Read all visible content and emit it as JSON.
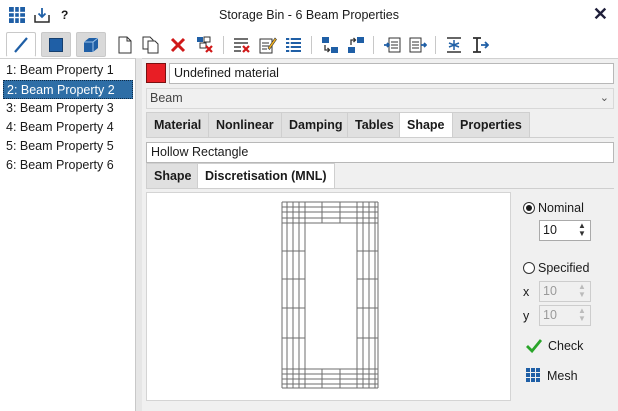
{
  "window": {
    "title": "Storage Bin - 6 Beam Properties",
    "help_label": "?"
  },
  "toolbar": {
    "icons": [
      "grid-app-icon",
      "download-icon",
      "help-icon",
      "line-mode-icon",
      "area-mode-icon",
      "solid-mode-icon",
      "new-page-icon",
      "copy-icon",
      "delete-icon",
      "delete-unused-icon",
      "delete-list-icon",
      "edit-list-icon",
      "list-icon",
      "import-icon",
      "export-icon",
      "insert-before-icon",
      "insert-after-icon",
      "align-center-icon",
      "section-icon"
    ]
  },
  "properties": {
    "items": [
      "1: Beam Property 1",
      "2: Beam Property 2",
      "3: Beam Property 3",
      "4: Beam Property 4",
      "5: Beam Property 5",
      "6: Beam Property 6"
    ],
    "selected_index": 1
  },
  "material": {
    "name": "Undefined material",
    "color": "#e81e25"
  },
  "element_type": {
    "value": "Beam"
  },
  "tabs": {
    "main": [
      "Material",
      "Nonlinear",
      "Damping",
      "Tables",
      "Shape",
      "Properties"
    ],
    "main_active": "Shape",
    "sub": [
      "Shape",
      "Discretisation (MNL)"
    ],
    "sub_active": "Discretisation (MNL)"
  },
  "shape": {
    "name": "Hollow Rectangle"
  },
  "discretisation": {
    "nominal_label": "Nominal",
    "nominal_value": "10",
    "nominal_selected": true,
    "specified_label": "Specified",
    "x_label": "x",
    "x_value": "10",
    "y_label": "y",
    "y_value": "10",
    "check_label": "Check",
    "mesh_label": "Mesh"
  },
  "colors": {
    "selection": "#2e6ea6",
    "accent": "#1f4e8c",
    "check": "#2aa52a"
  }
}
